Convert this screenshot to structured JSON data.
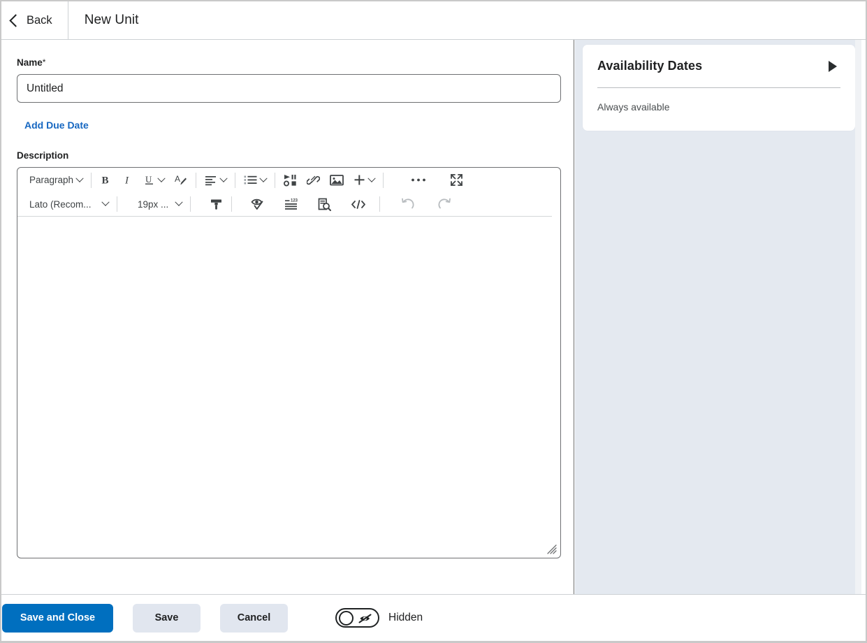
{
  "header": {
    "back_label": "Back",
    "title": "New Unit"
  },
  "form": {
    "name_label": "Name",
    "name_required_marker": "*",
    "name_value": "Untitled",
    "name_placeholder": "Untitled",
    "add_due_date_label": "Add Due Date",
    "description_label": "Description"
  },
  "editor": {
    "row1": {
      "paragraph_style": "Paragraph",
      "bold": "B",
      "italic": "I",
      "underline": "U"
    },
    "row2": {
      "font_family": "Lato (Recom...",
      "font_size": "19px ..."
    },
    "content": ""
  },
  "availability": {
    "title": "Availability Dates",
    "status": "Always available"
  },
  "footer": {
    "save_and_close_label": "Save and Close",
    "save_label": "Save",
    "cancel_label": "Cancel",
    "visibility_label": "Hidden",
    "visibility_on": false
  },
  "colors": {
    "primary": "#006fbf",
    "link": "#1667c1",
    "panel_bg": "#e4e9f0",
    "secondary_btn": "#e1e6ef",
    "border": "#6e7072",
    "text": "#202122"
  }
}
